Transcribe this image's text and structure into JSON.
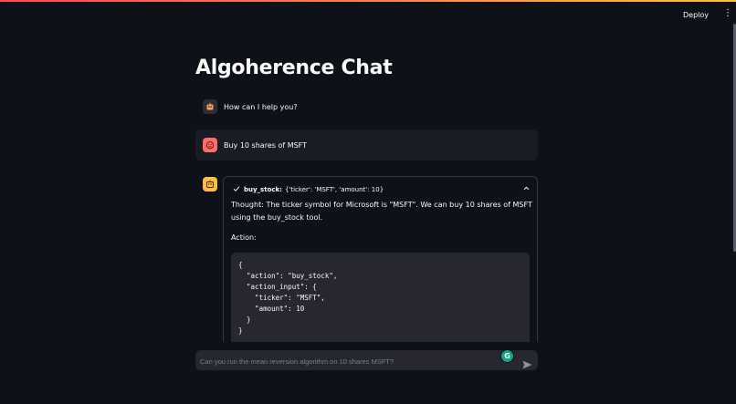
{
  "header": {
    "deploy_label": "Deploy",
    "menu_icon": "more-vertical-icon"
  },
  "page": {
    "title": "Algoherence Chat"
  },
  "messages": [
    {
      "role": "assistant",
      "avatar_icon": "robot-face-icon",
      "text": "How can I help you?"
    },
    {
      "role": "user",
      "avatar_icon": "user-face-icon",
      "text": "Buy 10 shares of MSFT"
    }
  ],
  "tool_call": {
    "status_icon": "check-icon",
    "name": "buy_stock:",
    "args": "{'ticker': 'MSFT', 'amount': 10}",
    "thought": "Thought: The ticker symbol for Microsoft is \"MSFT\". We can buy 10 shares of MSFT using the buy_stock tool.",
    "action_label": "Action:",
    "code": "{\n  \"action\": \"buy_stock\",\n  \"action_input\": {\n    \"ticker\": \"MSFT\",\n    \"amount\": 10\n  }\n}"
  },
  "chat_input": {
    "placeholder": "Can you run the mean reversion algorithm on 10 shares MSFT?",
    "value": ""
  },
  "colors": {
    "background": "#0e1117",
    "user_bubble": "#1a1c24",
    "user_avatar": "#ff6b6b",
    "assistant_avatar": "#ffbd45",
    "code_bg": "#262730"
  }
}
